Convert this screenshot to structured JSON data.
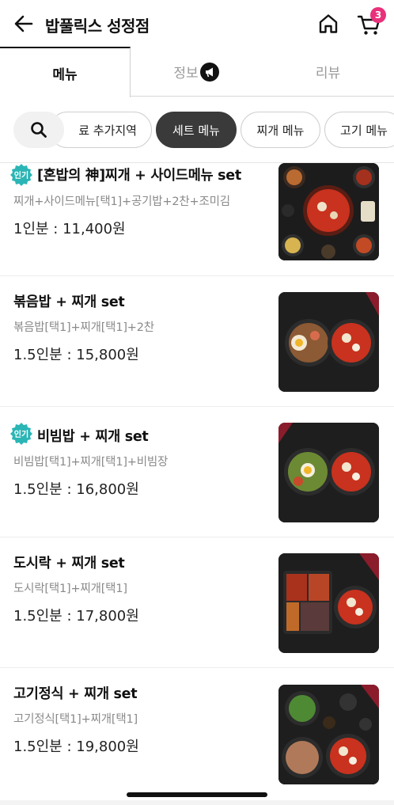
{
  "header": {
    "title": "밥풀릭스 성정점",
    "cart_count": "3",
    "back_icon": "arrow-left-icon",
    "home_icon": "home-icon",
    "cart_icon": "cart-icon"
  },
  "tabs": [
    {
      "label": "메뉴",
      "active": true
    },
    {
      "label": "정보",
      "active": false,
      "icon": "megaphone-icon"
    },
    {
      "label": "리뷰",
      "active": false
    }
  ],
  "categories": {
    "search_icon": "search-icon",
    "items": [
      {
        "label": "료 추가지역",
        "active": false
      },
      {
        "label": "세트 메뉴",
        "active": true
      },
      {
        "label": "찌개 메뉴",
        "active": false
      },
      {
        "label": "고기 메뉴",
        "active": false
      }
    ]
  },
  "menu_items": [
    {
      "badge": "인기",
      "name": "[혼밥의 神]찌개 + 사이드메뉴 set",
      "desc": "찌개+사이드메뉴[택1]+공기밥+2찬+조미김",
      "price": "1인분 : 11,400원"
    },
    {
      "badge": "",
      "name": "볶음밥 + 찌개 set",
      "desc": "볶음밥[택1]+찌개[택1]+2찬",
      "price": "1.5인분 : 15,800원"
    },
    {
      "badge": "인기",
      "name": "비빔밥 + 찌개 set",
      "desc": "비빔밥[택1]+찌개[택1]+비빔장",
      "price": "1.5인분 : 16,800원"
    },
    {
      "badge": "",
      "name": "도시락 + 찌개 set",
      "desc": "도시락[택1]+찌개[택1]",
      "price": "1.5인분 : 17,800원"
    },
    {
      "badge": "",
      "name": "고기정식 + 찌개 set",
      "desc": "고기정식[택1]+찌개[택1]",
      "price": "1.5인분 : 19,800원"
    }
  ],
  "colors": {
    "accent_badge": "#e8317a",
    "popular_badge": "#2bb5b5",
    "active_chip": "#3a3a3a"
  }
}
